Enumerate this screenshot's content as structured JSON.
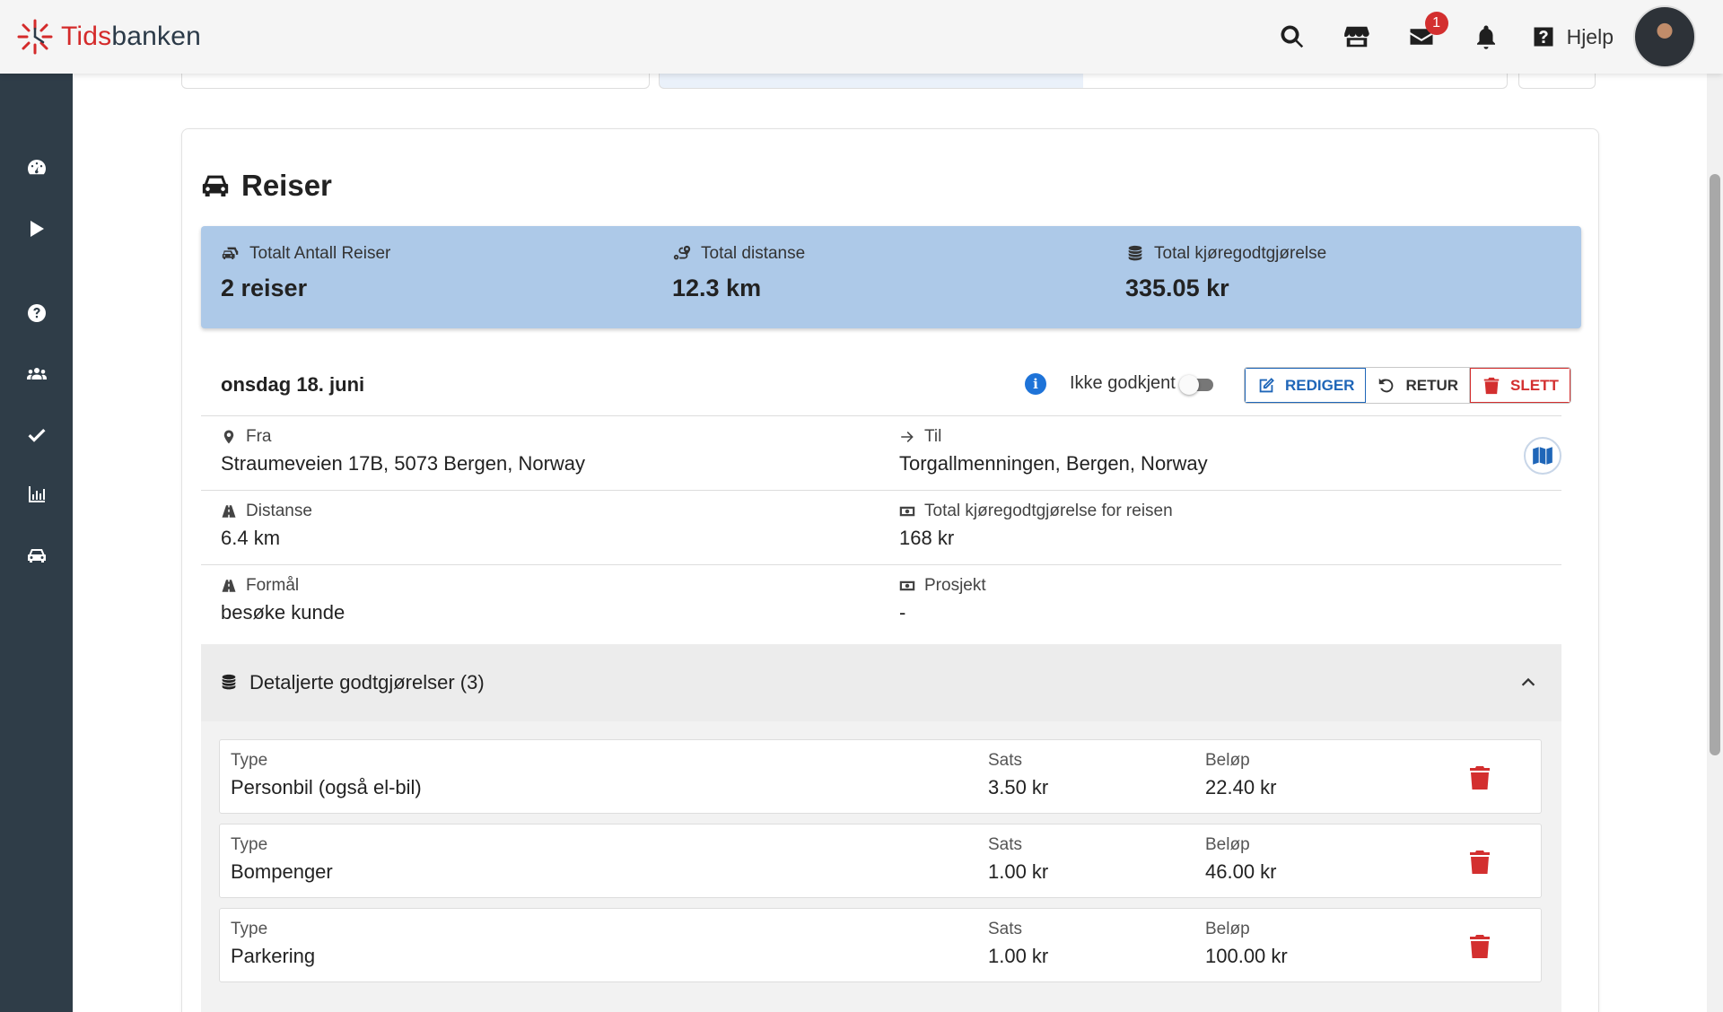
{
  "app": {
    "name_part1": "Tids",
    "name_part2": "banken",
    "help_label": "Hjelp",
    "mail_badge": "1"
  },
  "colors": {
    "sidebar": "#2f3d48",
    "summary_bg": "#adc9e8",
    "accent_blue": "#1f66b8",
    "danger": "#d32f2f",
    "brand_red": "#d42a2a"
  },
  "sidebar": {
    "items": [
      {
        "icon": "dashboard-icon"
      },
      {
        "icon": "play-icon"
      },
      {
        "icon": "question-icon"
      },
      {
        "icon": "users-icon"
      },
      {
        "icon": "check-icon"
      },
      {
        "icon": "chart-icon"
      },
      {
        "icon": "car-icon"
      }
    ]
  },
  "page": {
    "title": "Reiser"
  },
  "summary": {
    "trips_label": "Totalt Antall Reiser",
    "trips_value": "2 reiser",
    "distance_label": "Total distanse",
    "distance_value": "12.3 km",
    "allowance_label": "Total kjøregodtgjørelse",
    "allowance_value": "335.05 kr"
  },
  "trip": {
    "date": "onsdag 18. juni",
    "approval_label": "Ikke godkjent",
    "edit_label": "REDIGER",
    "return_label": "RETUR",
    "delete_label": "SLETT",
    "from_label": "Fra",
    "from_value": "Straumeveien 17B, 5073 Bergen, Norway",
    "to_label": "Til",
    "to_value": "Torgallmenningen, Bergen, Norway",
    "distance_label": "Distanse",
    "distance_value": "6.4 km",
    "total_label": "Total kjøregodtgjørelse for reisen",
    "total_value": "168 kr",
    "purpose_label": "Formål",
    "purpose_value": "besøke kunde",
    "project_label": "Prosjekt",
    "project_value": "-"
  },
  "details": {
    "title": "Detaljerte godtgjørelser (3)",
    "type_label": "Type",
    "rate_label": "Sats",
    "amount_label": "Beløp",
    "rows": [
      {
        "type": "Personbil (også el-bil)",
        "rate": "3.50 kr",
        "amount": "22.40 kr"
      },
      {
        "type": "Bompenger",
        "rate": "1.00 kr",
        "amount": "46.00 kr"
      },
      {
        "type": "Parkering",
        "rate": "1.00 kr",
        "amount": "100.00 kr"
      }
    ]
  }
}
